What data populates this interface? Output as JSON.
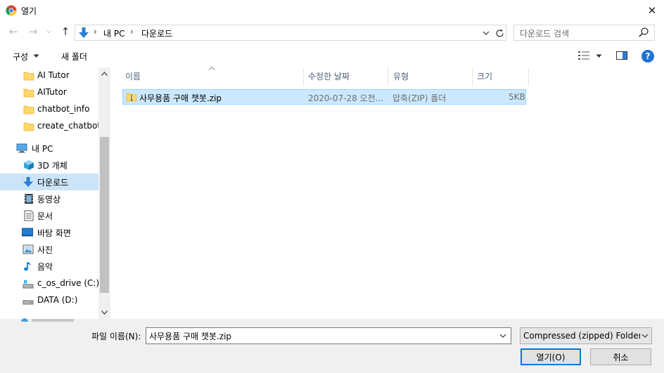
{
  "window": {
    "title": "열기",
    "close_symbol": "✕"
  },
  "nav": {
    "back_symbol": "←",
    "forward_symbol": "→",
    "recent_symbol": "⌄",
    "up_symbol": "↑",
    "breadcrumb": [
      "내 PC",
      "다운로드"
    ],
    "breadcrumb_sep": "›",
    "search_placeholder": "다운로드 검색"
  },
  "toolbar": {
    "organize": "구성",
    "new_folder": "새 폴더"
  },
  "sidebar": {
    "items": [
      {
        "label": "AI Tutor",
        "icon": "folder-icon"
      },
      {
        "label": "AITutor",
        "icon": "folder-icon"
      },
      {
        "label": "chatbot_info",
        "icon": "folder-icon"
      },
      {
        "label": "create_chatbot",
        "icon": "folder-icon"
      },
      {
        "label": "내 PC",
        "icon": "pc-icon"
      },
      {
        "label": "3D 개체",
        "icon": "cube-icon"
      },
      {
        "label": "다운로드",
        "icon": "download-icon",
        "selected": true
      },
      {
        "label": "동영상",
        "icon": "video-icon"
      },
      {
        "label": "문서",
        "icon": "document-icon"
      },
      {
        "label": "바탕 화면",
        "icon": "desktop-icon"
      },
      {
        "label": "사진",
        "icon": "picture-icon"
      },
      {
        "label": "음악",
        "icon": "music-icon"
      },
      {
        "label": "c_os_drive (C:)",
        "icon": "drive-icon"
      },
      {
        "label": "DATA (D:)",
        "icon": "drive-icon"
      }
    ]
  },
  "file_list": {
    "columns": [
      "이름",
      "수정한 날짜",
      "유형",
      "크기"
    ],
    "rows": [
      {
        "name": "사무용품 구매 챗봇.zip",
        "modified": "2020-07-28 오전...",
        "type": "압축(ZIP) 폴더",
        "size": "5KB",
        "selected": true
      }
    ]
  },
  "bottom": {
    "filename_label": "파일 이름(N):",
    "filename_value": "사무용품 구매 챗봇.zip",
    "filetype_value": "Compressed (zipped) Folder (*",
    "open_button": "열기(O)",
    "cancel_button": "취소"
  },
  "colors": {
    "accent": "#0078d7",
    "selection": "#cce8ff",
    "sidebar_selection": "#cce4f7",
    "folder": "#ffd86b"
  }
}
